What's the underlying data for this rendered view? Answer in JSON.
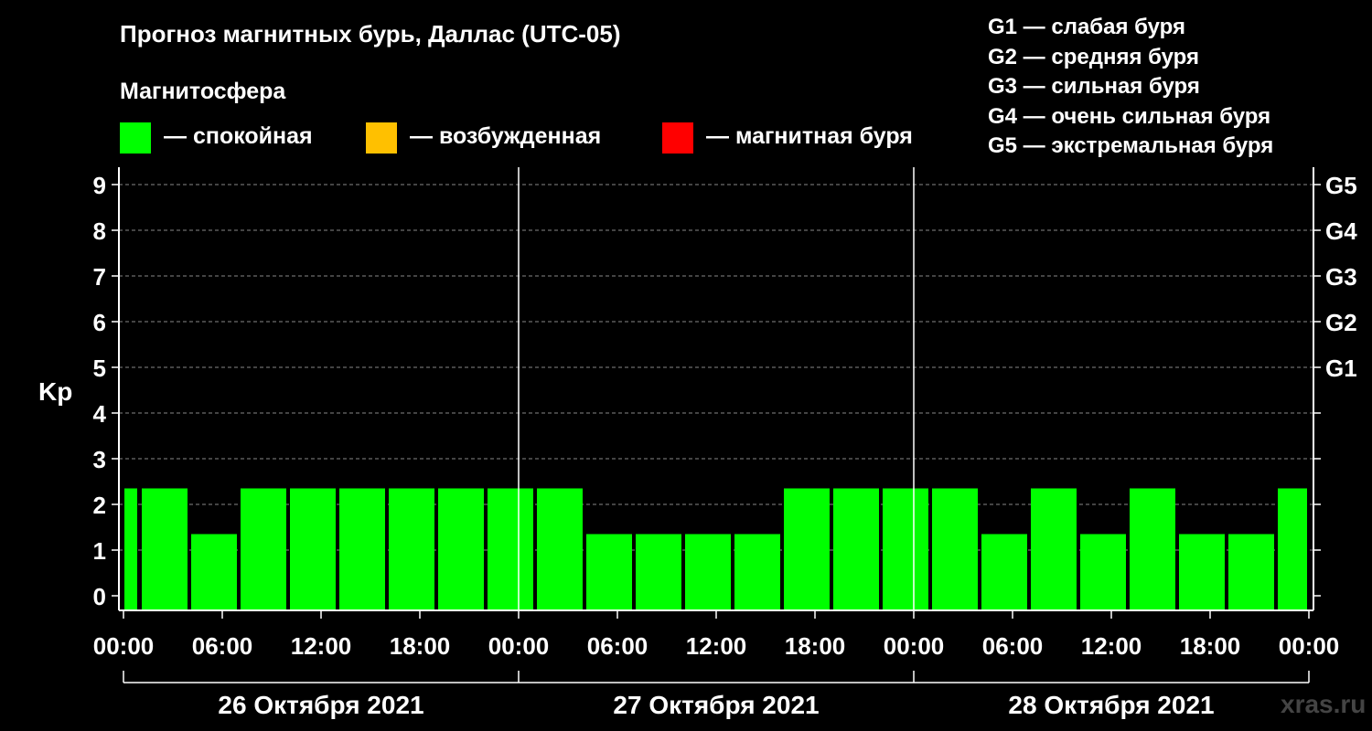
{
  "title": "Прогноз магнитных бурь, Даллас (UTC-05)",
  "subtitle": "Магнитосфера",
  "legend": [
    {
      "label": "— спокойная",
      "color": "#00ff00"
    },
    {
      "label": "— возбужденная",
      "color": "#ffc000"
    },
    {
      "label": "— магнитная буря",
      "color": "#ff0000"
    }
  ],
  "g_legend": [
    "G1 — слабая буря",
    "G2 — средняя буря",
    "G3 — сильная буря",
    "G4 — очень сильная буря",
    "G5 — экстремальная буря"
  ],
  "watermark": "xras.ru",
  "chart_data": {
    "type": "bar",
    "ylabel": "Kp",
    "ylim": [
      0,
      9
    ],
    "yticks": [
      0,
      1,
      2,
      3,
      4,
      5,
      6,
      7,
      8,
      9
    ],
    "right_axis_labels": [
      {
        "kp": 5,
        "label": "G1"
      },
      {
        "kp": 6,
        "label": "G2"
      },
      {
        "kp": 7,
        "label": "G3"
      },
      {
        "kp": 8,
        "label": "G4"
      },
      {
        "kp": 9,
        "label": "G5"
      }
    ],
    "x_tick_labels": [
      "00:00",
      "06:00",
      "12:00",
      "18:00",
      "00:00",
      "06:00",
      "12:00",
      "18:00",
      "00:00",
      "06:00",
      "12:00",
      "18:00",
      "00:00"
    ],
    "days": [
      "26 Октября 2021",
      "27 Октября 2021",
      "28 Октября 2021"
    ],
    "grid": "horizontal dashed",
    "bar_color": "#00ff00",
    "bars": [
      {
        "start": "2021-10-26 00:00",
        "end": "2021-10-26 01:00",
        "kp": 2
      },
      {
        "start": "2021-10-26 01:00",
        "end": "2021-10-26 04:00",
        "kp": 2
      },
      {
        "start": "2021-10-26 04:00",
        "end": "2021-10-26 07:00",
        "kp": 1
      },
      {
        "start": "2021-10-26 07:00",
        "end": "2021-10-26 10:00",
        "kp": 2
      },
      {
        "start": "2021-10-26 10:00",
        "end": "2021-10-26 13:00",
        "kp": 2
      },
      {
        "start": "2021-10-26 13:00",
        "end": "2021-10-26 16:00",
        "kp": 2
      },
      {
        "start": "2021-10-26 16:00",
        "end": "2021-10-26 19:00",
        "kp": 2
      },
      {
        "start": "2021-10-26 19:00",
        "end": "2021-10-26 22:00",
        "kp": 2
      },
      {
        "start": "2021-10-26 22:00",
        "end": "2021-10-27 01:00",
        "kp": 2
      },
      {
        "start": "2021-10-27 01:00",
        "end": "2021-10-27 04:00",
        "kp": 2
      },
      {
        "start": "2021-10-27 04:00",
        "end": "2021-10-27 07:00",
        "kp": 1
      },
      {
        "start": "2021-10-27 07:00",
        "end": "2021-10-27 10:00",
        "kp": 1
      },
      {
        "start": "2021-10-27 10:00",
        "end": "2021-10-27 13:00",
        "kp": 1
      },
      {
        "start": "2021-10-27 13:00",
        "end": "2021-10-27 16:00",
        "kp": 1
      },
      {
        "start": "2021-10-27 16:00",
        "end": "2021-10-27 19:00",
        "kp": 2
      },
      {
        "start": "2021-10-27 19:00",
        "end": "2021-10-27 22:00",
        "kp": 2
      },
      {
        "start": "2021-10-27 22:00",
        "end": "2021-10-28 01:00",
        "kp": 2
      },
      {
        "start": "2021-10-28 01:00",
        "end": "2021-10-28 04:00",
        "kp": 2
      },
      {
        "start": "2021-10-28 04:00",
        "end": "2021-10-28 07:00",
        "kp": 1
      },
      {
        "start": "2021-10-28 07:00",
        "end": "2021-10-28 10:00",
        "kp": 2
      },
      {
        "start": "2021-10-28 10:00",
        "end": "2021-10-28 13:00",
        "kp": 1
      },
      {
        "start": "2021-10-28 13:00",
        "end": "2021-10-28 16:00",
        "kp": 2
      },
      {
        "start": "2021-10-28 16:00",
        "end": "2021-10-28 19:00",
        "kp": 1
      },
      {
        "start": "2021-10-28 19:00",
        "end": "2021-10-28 22:00",
        "kp": 1
      },
      {
        "start": "2021-10-28 22:00",
        "end": "2021-10-29 00:00",
        "kp": 2
      }
    ]
  }
}
